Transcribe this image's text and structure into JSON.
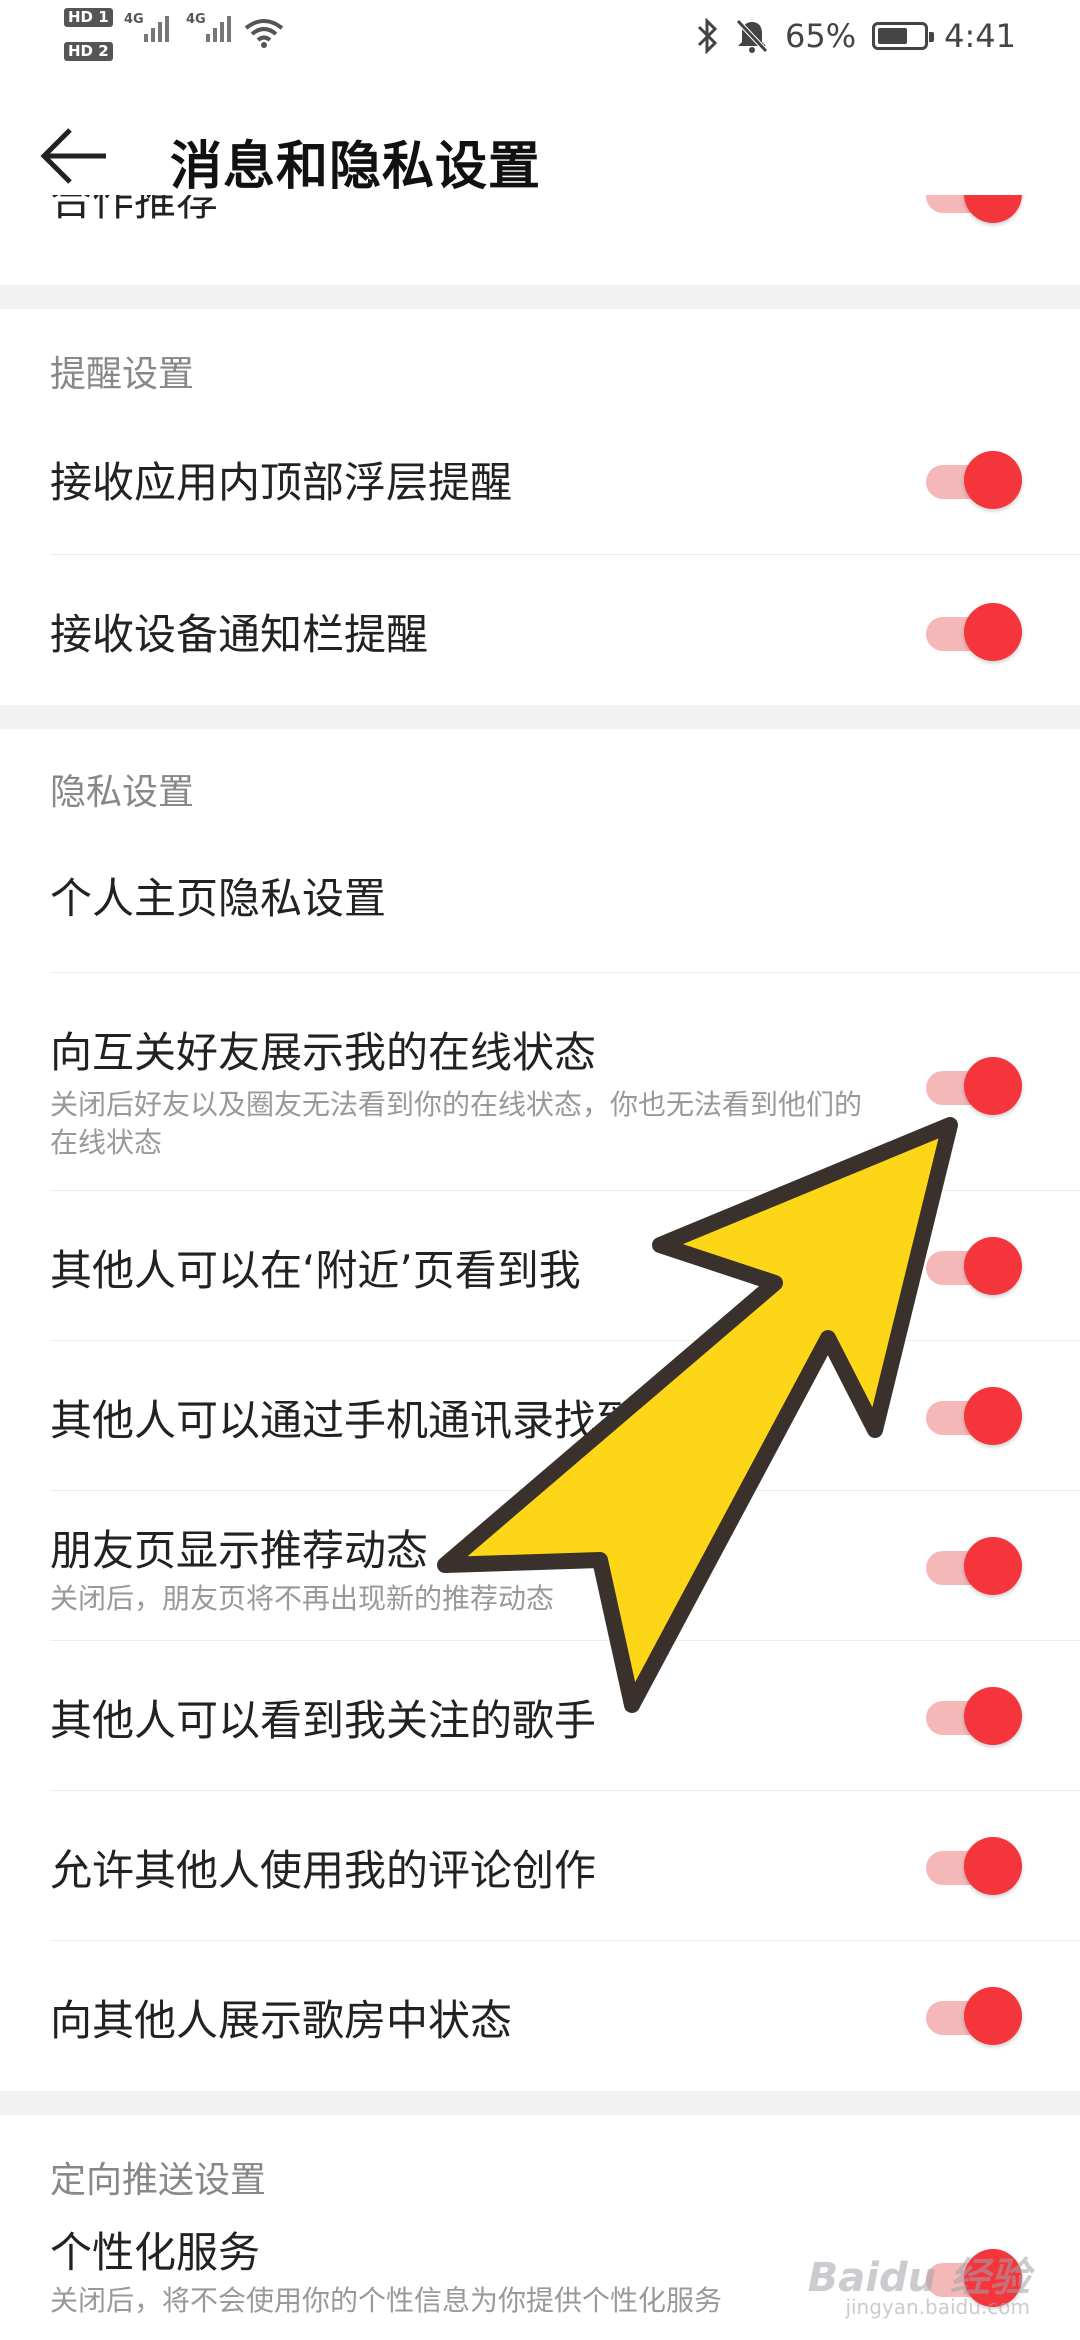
{
  "status_bar": {
    "hd1": "HD 1",
    "hd2": "HD 2",
    "sig1": "4G",
    "sig2": "4G",
    "battery_pct": "65%",
    "battery_level": 0.65,
    "time": "4:41"
  },
  "header": {
    "title": "消息和隐私设置"
  },
  "top_partial": {
    "label": "合作推荐"
  },
  "sections": [
    {
      "title": "提醒设置",
      "items": [
        {
          "label": "接收应用内顶部浮层提醒",
          "sub": "",
          "toggle": true
        },
        {
          "label": "接收设备通知栏提醒",
          "sub": "",
          "toggle": true
        }
      ]
    },
    {
      "title": "隐私设置",
      "items": [
        {
          "label": "个人主页隐私设置",
          "sub": "",
          "toggle": false
        },
        {
          "label": "向互关好友展示我的在线状态",
          "sub": "关闭后好友以及圈友无法看到你的在线状态，你也无法看到他们的在线状态",
          "toggle": true
        },
        {
          "label": "其他人可以在‘附近’页看到我",
          "sub": "",
          "toggle": true
        },
        {
          "label": "其他人可以通过手机通讯录找到我",
          "sub": "",
          "toggle": true
        },
        {
          "label": "朋友页显示推荐动态",
          "sub": "关闭后，朋友页将不再出现新的推荐动态",
          "toggle": true
        },
        {
          "label": "其他人可以看到我关注的歌手",
          "sub": "",
          "toggle": true
        },
        {
          "label": "允许其他人使用我的评论创作",
          "sub": "",
          "toggle": true
        },
        {
          "label": "向其他人展示歌房中状态",
          "sub": "",
          "toggle": true
        }
      ]
    },
    {
      "title": "定向推送设置",
      "items": [
        {
          "label": "个性化服务",
          "sub": "关闭后，将不会使用你的个性信息为你提供个性化服务",
          "toggle": true
        }
      ]
    }
  ],
  "watermark": {
    "brand": "Baidu 经验",
    "url": "jingyan.baidu.com"
  },
  "colors": {
    "accent": "#f5353c",
    "track": "#f4b8b8",
    "arrow_fill": "#fdd717",
    "arrow_stroke": "#3a302c"
  },
  "icons": {
    "back": "arrow-left-icon",
    "bluetooth": "bluetooth-icon",
    "mute": "bell-off-icon",
    "wifi": "wifi-icon"
  }
}
